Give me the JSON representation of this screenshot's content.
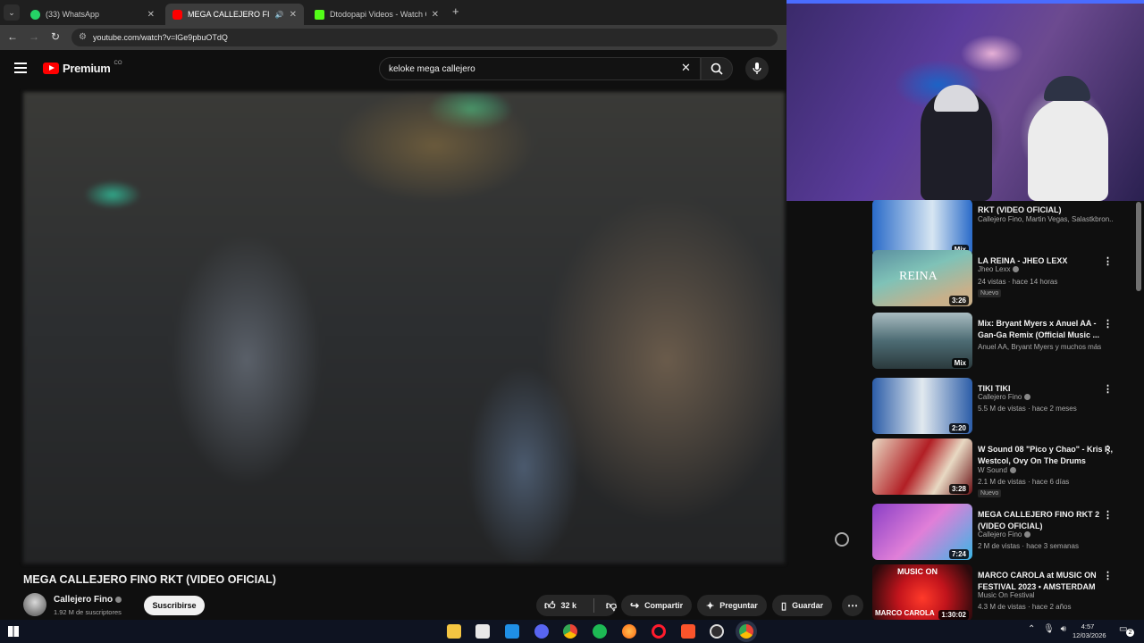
{
  "browser": {
    "tabs": [
      {
        "label": "(33) WhatsApp",
        "active": false,
        "favicon_color": "#25d366"
      },
      {
        "label": "MEGA CALLEJERO FINO RK",
        "active": true,
        "favicon_color": "#ff0000"
      },
      {
        "label": "Dtodopapi Videos - Watch On",
        "active": false,
        "favicon_color": "#53fc18"
      }
    ],
    "new_tab": "+",
    "url": "youtube.com/watch?v=lGe9pbuOTdQ"
  },
  "youtube": {
    "logo_text": "Premium",
    "logo_country": "CO",
    "search_query": "keloke  mega callejero",
    "video": {
      "title": "MEGA CALLEJERO FINO RKT (VIDEO OFICIAL)",
      "channel": "Callejero Fino",
      "subscribers": "1.92 M de suscriptores",
      "subscribe_label": "Suscribirse",
      "likes": "32 k",
      "share_label": "Compartir",
      "ask_label": "Preguntar",
      "save_label": "Guardar"
    },
    "recommendations": [
      {
        "title": "RKT (VIDEO OFICIAL)",
        "channel": "Callejero Fino, Martin Vegas, Salastkbron...",
        "meta": "",
        "badge": "Mix",
        "new": "",
        "thumb": [
          "#2a6bc9",
          "#d7e6f2"
        ]
      },
      {
        "title": "LA REINA - JHEO LEXX",
        "channel": "Jheo Lexx",
        "meta": "24 vistas · hace 14 horas",
        "badge": "3:26",
        "new": "Nuevo",
        "thumb": [
          "#7fc2b7",
          "#c8b08a"
        ]
      },
      {
        "title": "Mix: Bryant Myers x Anuel AA - Gan-Ga Remix (Official Music ...",
        "channel": "Anuel AA, Bryant Myers y muchos más",
        "meta": "",
        "badge": "Mix",
        "new": "",
        "thumb": [
          "#4d6c74",
          "#a9bcc1"
        ]
      },
      {
        "title": "TIKI TIKI",
        "channel": "Callejero Fino",
        "meta": "5.5 M de vistas · hace 2 meses",
        "badge": "2:20",
        "new": "",
        "thumb": [
          "#2c5da8",
          "#e1e9ef"
        ]
      },
      {
        "title": "W Sound 08 \"Pico y Chao\" - Kris R, Westcol, Ovy On The Drums",
        "channel": "W Sound",
        "meta": "2.1 M de vistas · hace 6 días",
        "badge": "3:28",
        "new": "Nuevo",
        "thumb": [
          "#b21f25",
          "#e8d9c3"
        ]
      },
      {
        "title": "MEGA CALLEJERO FINO RKT 2 (VIDEO OFICIAL)",
        "channel": "Callejero Fino",
        "meta": "2 M de vistas · hace 3 semanas",
        "badge": "7:24",
        "new": "",
        "thumb": [
          "#8a3fc6",
          "#e07fd8"
        ]
      },
      {
        "title": "MARCO CAROLA at MUSIC ON FESTIVAL 2023 • AMSTERDAM",
        "channel": "Music On Festival",
        "meta": "4.3 M de vistas · hace 2 años",
        "badge": "1:30:02",
        "new": "",
        "thumb": [
          "#c2141c",
          "#2a0a0c"
        ]
      }
    ],
    "thumb_captions": {
      "reina": "REINA",
      "music_on": "MUSIC ON",
      "marco": "MARCO CAROLA"
    }
  },
  "taskbar": {
    "time": "4:57",
    "date": "12/03/2026",
    "notifications": "2",
    "apps": [
      "windows-start",
      "file-explorer",
      "store",
      "mail",
      "discord",
      "chrome",
      "spotify",
      "firefox",
      "opera",
      "brave",
      "obs",
      "chrome-profile"
    ]
  }
}
